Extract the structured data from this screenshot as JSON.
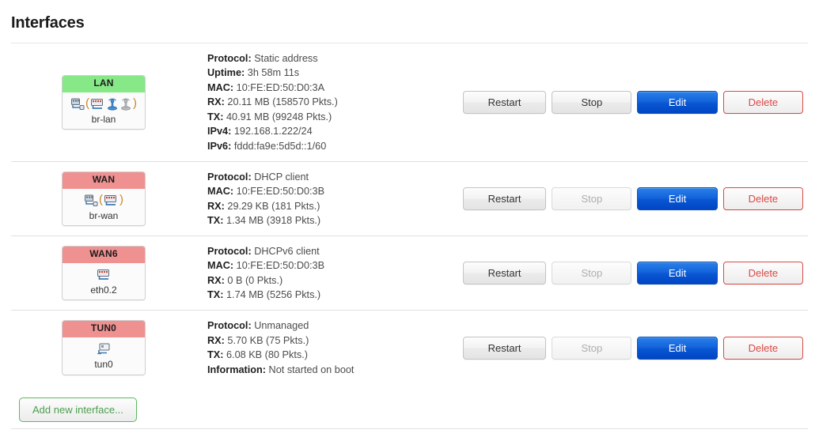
{
  "page": {
    "title": "Interfaces"
  },
  "actions": {
    "restart_label": "Restart",
    "stop_label": "Stop",
    "edit_label": "Edit",
    "delete_label": "Delete",
    "add_label": "Add new interface..."
  },
  "colors": {
    "up_badge": "#87e887",
    "down_badge": "#f09191",
    "edit_blue": "#0a56d2",
    "delete_red": "#d94a46",
    "add_green": "#5cb85c"
  },
  "interfaces": [
    {
      "name": "LAN",
      "state": "up",
      "device": "br-lan",
      "icons": [
        "ethernet-adapter-icon",
        "open-paren",
        "switch-icon",
        "wifi-active-icon",
        "wifi-inactive-icon",
        "close-paren"
      ],
      "details": [
        {
          "label": "Protocol:",
          "value": "Static address"
        },
        {
          "label": "Uptime:",
          "value": "3h 58m 11s"
        },
        {
          "label": "MAC:",
          "value": "10:FE:ED:50:D0:3A"
        },
        {
          "label": "RX:",
          "value": "20.11 MB (158570 Pkts.)"
        },
        {
          "label": "TX:",
          "value": "40.91 MB (99248 Pkts.)"
        },
        {
          "label": "IPv4:",
          "value": "192.168.1.222/24"
        },
        {
          "label": "IPv6:",
          "value": "fddd:fa9e:5d5d::1/60"
        }
      ],
      "stop_enabled": true
    },
    {
      "name": "WAN",
      "state": "down",
      "device": "br-wan",
      "icons": [
        "ethernet-adapter-icon",
        "open-paren",
        "switch-icon",
        "close-paren"
      ],
      "details": [
        {
          "label": "Protocol:",
          "value": "DHCP client"
        },
        {
          "label": "MAC:",
          "value": "10:FE:ED:50:D0:3B"
        },
        {
          "label": "RX:",
          "value": "29.29 KB (181 Pkts.)"
        },
        {
          "label": "TX:",
          "value": "1.34 MB (3918 Pkts.)"
        }
      ],
      "stop_enabled": false
    },
    {
      "name": "WAN6",
      "state": "down",
      "device": "eth0.2",
      "icons": [
        "switch-icon"
      ],
      "details": [
        {
          "label": "Protocol:",
          "value": "DHCPv6 client"
        },
        {
          "label": "MAC:",
          "value": "10:FE:ED:50:D0:3B"
        },
        {
          "label": "RX:",
          "value": "0 B (0 Pkts.)"
        },
        {
          "label": "TX:",
          "value": "1.74 MB (5256 Pkts.)"
        }
      ],
      "stop_enabled": false
    },
    {
      "name": "TUN0",
      "state": "down",
      "device": "tun0",
      "icons": [
        "tunnel-icon"
      ],
      "details": [
        {
          "label": "Protocol:",
          "value": "Unmanaged"
        },
        {
          "label": "RX:",
          "value": "5.70 KB (75 Pkts.)"
        },
        {
          "label": "TX:",
          "value": "6.08 KB (80 Pkts.)"
        },
        {
          "label": "Information:",
          "value": "Not started on boot"
        }
      ],
      "stop_enabled": false
    }
  ]
}
